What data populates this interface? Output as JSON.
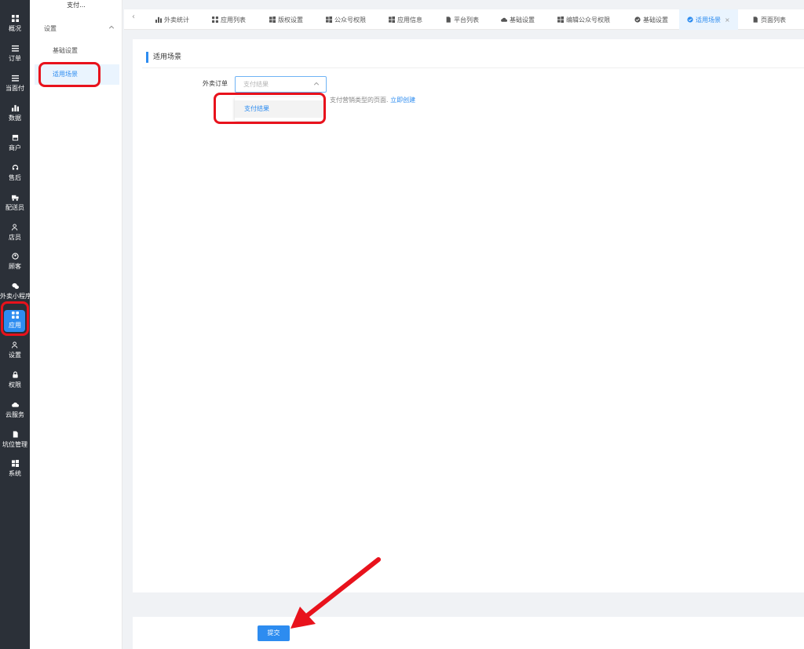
{
  "rail": {
    "items": [
      {
        "label": "概况",
        "icon": "grid-icon"
      },
      {
        "label": "订单",
        "icon": "list-icon"
      },
      {
        "label": "当面付",
        "icon": "list-icon"
      },
      {
        "label": "数据",
        "icon": "bar-chart-icon"
      },
      {
        "label": "商户",
        "icon": "store-icon"
      },
      {
        "label": "售后",
        "icon": "headset-icon"
      },
      {
        "label": "配送员",
        "icon": "delivery-icon"
      },
      {
        "label": "店员",
        "icon": "users-icon"
      },
      {
        "label": "顾客",
        "icon": "customer-icon"
      },
      {
        "label": "外卖小程序",
        "icon": "wechat-icon"
      },
      {
        "label": "应用",
        "icon": "apps-icon"
      },
      {
        "label": "设置",
        "icon": "user-settings-icon"
      },
      {
        "label": "权限",
        "icon": "lock-icon"
      },
      {
        "label": "云服务",
        "icon": "cloud-icon"
      },
      {
        "label": "坑位管理",
        "icon": "file-icon"
      },
      {
        "label": "系统",
        "icon": "windows-icon"
      }
    ],
    "active_index": 10
  },
  "subnav": {
    "header": "支付...",
    "group": "设置",
    "items": [
      "基础设置",
      "适用场景"
    ]
  },
  "tabs": [
    {
      "label": "外卖统计",
      "icon": "bar-chart-icon"
    },
    {
      "label": "应用列表",
      "icon": "apps-icon"
    },
    {
      "label": "版权设置",
      "icon": "windows-icon"
    },
    {
      "label": "公众号权限",
      "icon": "windows-icon"
    },
    {
      "label": "应用信息",
      "icon": "windows-icon"
    },
    {
      "label": "平台列表",
      "icon": "file-icon"
    },
    {
      "label": "基础设置",
      "icon": "cloud-icon"
    },
    {
      "label": "编辑公众号权限",
      "icon": "windows-icon"
    },
    {
      "label": "基础设置",
      "icon": "check-circle-icon"
    },
    {
      "label": "适用场景",
      "icon": "check-circle-icon",
      "close": "×"
    },
    {
      "label": "页面列表",
      "icon": "file-icon"
    }
  ],
  "form": {
    "section_title": "适用场景",
    "field_label": "外卖订单",
    "select_placeholder": "支付结果",
    "hint_text": "支付营销类型的页面.",
    "hint_link": "立即创建",
    "dropdown_option": "支付结果"
  },
  "footer": {
    "submit_label": "提交"
  },
  "colors": {
    "primary": "#2d8cf0",
    "rail_bg": "#2b3038",
    "annotation_red": "#e8121c"
  }
}
